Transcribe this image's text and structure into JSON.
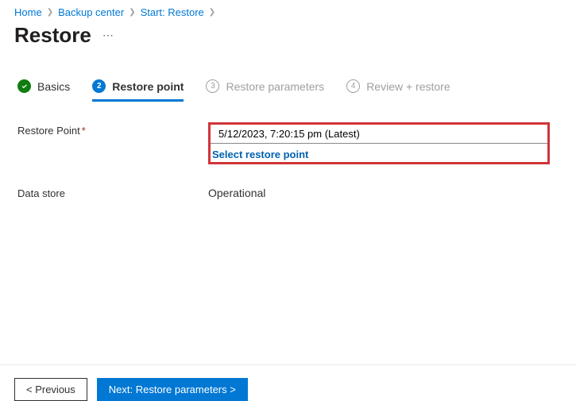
{
  "breadcrumb": {
    "home": "Home",
    "backup_center": "Backup center",
    "start_restore": "Start: Restore"
  },
  "page": {
    "title": "Restore"
  },
  "tabs": {
    "basics": "Basics",
    "restore_point": {
      "num": "2",
      "label": "Restore point"
    },
    "restore_parameters": {
      "num": "3",
      "label": "Restore parameters"
    },
    "review": {
      "num": "4",
      "label": "Review + restore"
    }
  },
  "form": {
    "restore_point_label": "Restore Point",
    "restore_point_value": "5/12/2023, 7:20:15 pm (Latest)",
    "select_link": "Select restore point",
    "data_store_label": "Data store",
    "data_store_value": "Operational"
  },
  "footer": {
    "prev": "< Previous",
    "next": "Next: Restore parameters >"
  }
}
